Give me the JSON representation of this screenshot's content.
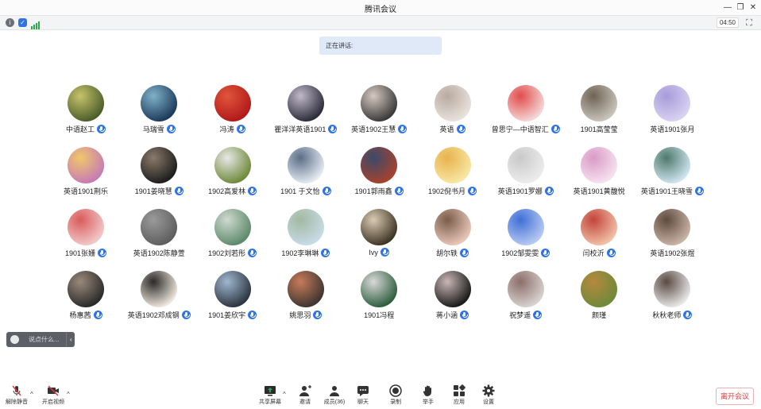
{
  "window": {
    "title": "腾讯会议"
  },
  "info": {
    "timer": "04:50"
  },
  "speaking_label": "正在讲话:",
  "chat": {
    "placeholder": "说点什么..."
  },
  "participants": [
    {
      "name": "中语赵工",
      "mic": true,
      "c1": "#4b5e2a",
      "c2": "#c7c26b"
    },
    {
      "name": "马瑞雪",
      "mic": true,
      "c1": "#1c3a5a",
      "c2": "#7fb2c9"
    },
    {
      "name": "冯涛",
      "mic": true,
      "c1": "#b11a1a",
      "c2": "#e0553b"
    },
    {
      "name": "瞿洋洋英语1901",
      "mic": true,
      "c1": "#2c2c3a",
      "c2": "#c0b9c9"
    },
    {
      "name": "英语1902王慧",
      "mic": true,
      "c1": "#3a3a3a",
      "c2": "#d6c9c0"
    },
    {
      "name": "英语",
      "mic": true,
      "c1": "#e8e2dc",
      "c2": "#b9aaa0"
    },
    {
      "name": "曾思宁—中语智汇",
      "mic": true,
      "c1": "#f4d7d7",
      "c2": "#e24c4c"
    },
    {
      "name": "1901高莹莹",
      "mic": false,
      "c1": "#c9c4bb",
      "c2": "#6f6354"
    },
    {
      "name": "英语1901张月",
      "mic": false,
      "c1": "#d8d2f2",
      "c2": "#a89bd9"
    },
    {
      "name": "英语1901荆乐",
      "mic": false,
      "c1": "#c67bb5",
      "c2": "#f0c76a"
    },
    {
      "name": "1901姜晓慧",
      "mic": true,
      "c1": "#1d1d1d",
      "c2": "#8a7a6a"
    },
    {
      "name": "1902高爱林",
      "mic": true,
      "c1": "#6f8a3a",
      "c2": "#e8e8e8"
    },
    {
      "name": "1901 于文怡",
      "mic": true,
      "c1": "#e4eaf2",
      "c2": "#5a6e86"
    },
    {
      "name": "1901郭雨鑫",
      "mic": true,
      "c1": "#a7422e",
      "c2": "#3b4a6a"
    },
    {
      "name": "1902倪书月",
      "mic": true,
      "c1": "#f6e7a3",
      "c2": "#e9b24c"
    },
    {
      "name": "英语1901罗娜",
      "mic": true,
      "c1": "#ececec",
      "c2": "#c9c9c9"
    },
    {
      "name": "英语1901黄馥悦",
      "mic": false,
      "c1": "#f7e1ef",
      "c2": "#d99bc7"
    },
    {
      "name": "英语1901王晓雪",
      "mic": true,
      "c1": "#cfe4ef",
      "c2": "#4e7a6b"
    },
    {
      "name": "1901张姗",
      "mic": true,
      "c1": "#f2c8c8",
      "c2": "#d95b5b"
    },
    {
      "name": "英语1902陈静萱",
      "mic": false,
      "c1": "#5e5e5e",
      "c2": "#9a9a9a"
    },
    {
      "name": "1902刘若彤",
      "mic": true,
      "c1": "#5e8a6a",
      "c2": "#cfd9d0"
    },
    {
      "name": "1902李琳琳",
      "mic": true,
      "c1": "#c7dbe6",
      "c2": "#a3b8a1"
    },
    {
      "name": "Ivy",
      "mic": true,
      "c1": "#3f3424",
      "c2": "#d9cbb3"
    },
    {
      "name": "胡尔轶",
      "mic": true,
      "c1": "#e8c7b9",
      "c2": "#7a5c4a"
    },
    {
      "name": "1902邹雯雯",
      "mic": true,
      "c1": "#b7c9f2",
      "c2": "#3f6fd6"
    },
    {
      "name": "闫校沂",
      "mic": true,
      "c1": "#f2c0a8",
      "c2": "#c2443a"
    },
    {
      "name": "英语1902张煜",
      "mic": false,
      "c1": "#c9b3a5",
      "c2": "#5e4a3e"
    },
    {
      "name": "杨惠茜",
      "mic": true,
      "c1": "#2a2a2a",
      "c2": "#9a8a7a"
    },
    {
      "name": "英语1902邓成钢",
      "mic": true,
      "c1": "#efe6dc",
      "c2": "#2a2a2a"
    },
    {
      "name": "1901姜欣宇",
      "mic": true,
      "c1": "#2d3540",
      "c2": "#9fb7cf"
    },
    {
      "name": "姚思羽",
      "mic": true,
      "c1": "#3e3530",
      "c2": "#c77b5a"
    },
    {
      "name": "1901冯程",
      "mic": false,
      "c1": "#2f5e3e",
      "c2": "#d9d9d9"
    },
    {
      "name": "蒋小涵",
      "mic": true,
      "c1": "#1a1a1a",
      "c2": "#c9b6b6"
    },
    {
      "name": "祝梦遥",
      "mic": true,
      "c1": "#d8d2cf",
      "c2": "#8c6e6a"
    },
    {
      "name": "颜瑾",
      "mic": false,
      "c1": "#6e8a3a",
      "c2": "#b5883f"
    },
    {
      "name": "秋秋老师",
      "mic": true,
      "c1": "#e7e7e7",
      "c2": "#5a4a42"
    }
  ],
  "toolbar": {
    "unmute": "解除静音",
    "start_video": "开启视频",
    "share_screen": "共享屏幕",
    "invite": "邀请",
    "members": "成员(36)",
    "chat": "聊天",
    "record": "录制",
    "raise_hand": "举手",
    "apps": "应用",
    "settings": "设置",
    "leave": "离开会议"
  },
  "colors": {
    "accent": "#2f73e8",
    "leave": "#d64545",
    "banner": "#dfe9f8"
  }
}
